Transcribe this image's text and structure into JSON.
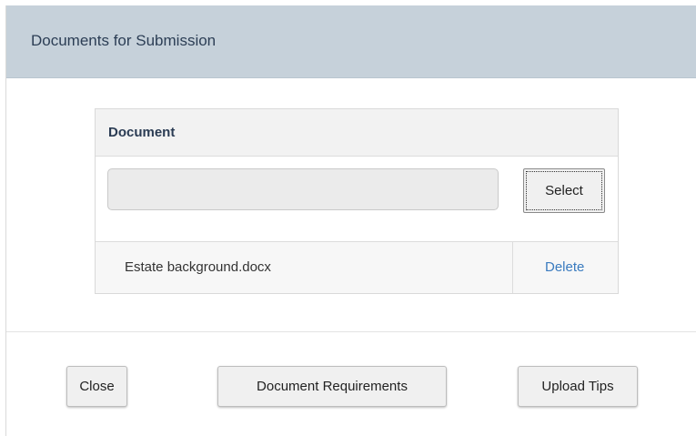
{
  "dialog": {
    "title": "Documents for Submission"
  },
  "table": {
    "header": "Document",
    "file_input": {
      "value": "",
      "placeholder": ""
    },
    "select_label": "Select",
    "files": [
      {
        "name": "Estate background.docx",
        "action": "Delete"
      }
    ]
  },
  "footer": {
    "close_label": "Close",
    "requirements_label": "Document Requirements",
    "tips_label": "Upload Tips"
  },
  "colors": {
    "header_bg": "#c6d1da",
    "link": "#3a7bbf",
    "table_header_text": "#2b3c54"
  }
}
